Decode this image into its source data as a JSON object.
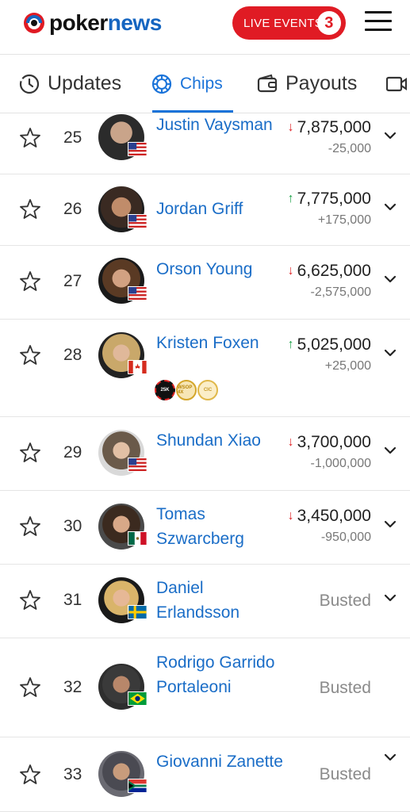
{
  "header": {
    "logo_poker": "poker",
    "logo_news": "news",
    "live_events_label": "LIVE EVENTS",
    "live_events_count": "3"
  },
  "tabs": [
    {
      "label": "Updates",
      "icon": "clock-icon"
    },
    {
      "label": "Chips",
      "icon": "chip-icon",
      "active": true
    },
    {
      "label": "Payouts",
      "icon": "wallet-icon"
    },
    {
      "label": "",
      "icon": "video-icon"
    }
  ],
  "players": [
    {
      "rank": "25",
      "name": "Justin Vaysman",
      "chips": "7,875,000",
      "change": "-25,000",
      "trend": "down",
      "flag": "US"
    },
    {
      "rank": "26",
      "name": "Jordan Griff",
      "chips": "7,775,000",
      "change": "+175,000",
      "trend": "up",
      "flag": "US"
    },
    {
      "rank": "27",
      "name": "Orson Young",
      "chips": "6,625,000",
      "change": "-2,575,000",
      "trend": "down",
      "flag": "US"
    },
    {
      "rank": "28",
      "name": "Kristen Foxen",
      "chips": "5,025,000",
      "change": "+25,000",
      "trend": "up",
      "flag": "CA",
      "badges": [
        "25K",
        "WSOP 4X",
        "CIC"
      ]
    },
    {
      "rank": "29",
      "name": "Shundan Xiao",
      "chips": "3,700,000",
      "change": "-1,000,000",
      "trend": "down",
      "flag": "US"
    },
    {
      "rank": "30",
      "name": "Tomas Szwarcberg",
      "chips": "3,450,000",
      "change": "-950,000",
      "trend": "down",
      "flag": "MX"
    },
    {
      "rank": "31",
      "name": "Daniel Erlandsson",
      "status": "Busted",
      "flag": "SE"
    },
    {
      "rank": "32",
      "name": "Rodrigo Garrido Portaleoni",
      "status": "Busted",
      "flag": "BR"
    },
    {
      "rank": "33",
      "name": "Giovanni Zanette",
      "status": "Busted",
      "flag": "ZA"
    }
  ],
  "colors": {
    "brand_red": "#e01b24",
    "link_blue": "#1a6dc7",
    "down": "#e0262a",
    "up": "#1ea34a"
  }
}
